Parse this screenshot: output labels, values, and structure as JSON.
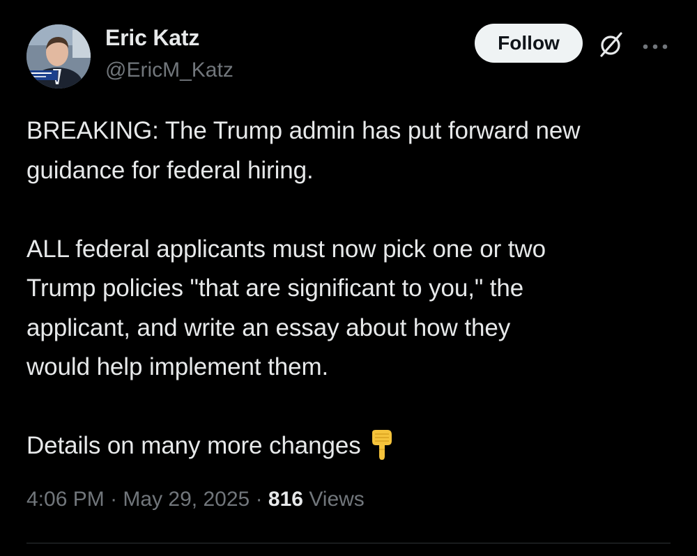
{
  "author": {
    "name": "Eric Katz",
    "handle": "@EricM_Katz"
  },
  "actions": {
    "follow_label": "Follow",
    "grok_icon": "grok-icon",
    "more_icon": "more-options-icon"
  },
  "tweet": {
    "lines": [
      "BREAKING: The Trump admin has put forward new",
      "guidance for federal hiring.",
      "ALL federal applicants must now pick one or two",
      "Trump policies \"that are significant to you,\" the",
      "applicant, and write an essay about how they",
      "would help implement them.",
      "Details on many more changes"
    ],
    "emoji": "backhand-index-pointing-down"
  },
  "meta": {
    "time": "4:06 PM",
    "separator": "·",
    "date": "May 29, 2025",
    "views_count": "816",
    "views_label": "Views"
  },
  "colors": {
    "background": "#000000",
    "text": "#e7e9ea",
    "secondary": "#71767b",
    "follow_bg": "#eff3f4",
    "divider": "#2f3336"
  }
}
